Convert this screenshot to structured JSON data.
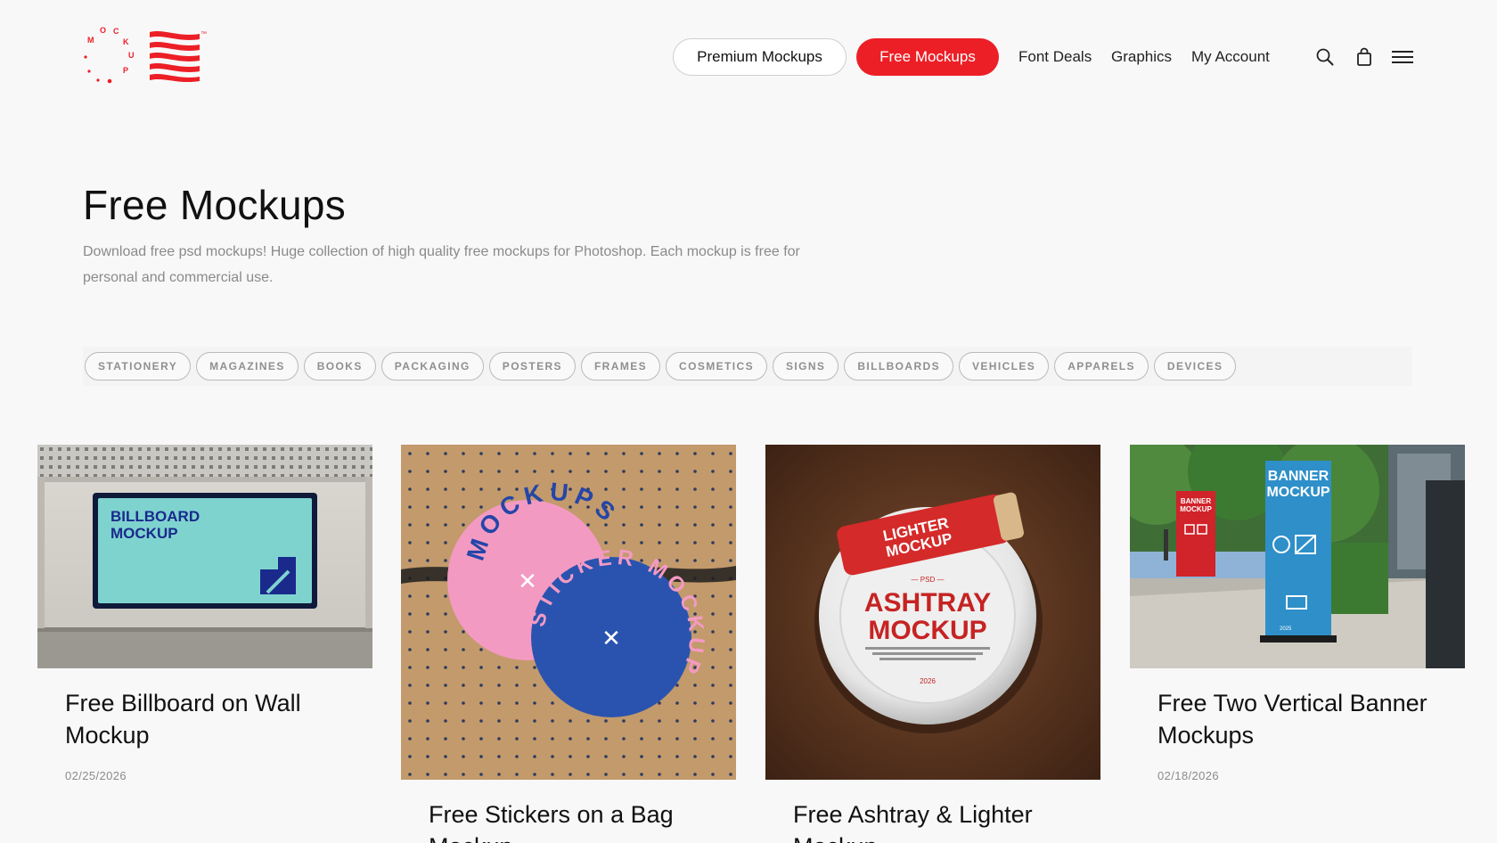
{
  "logo": {
    "ring_text": "MOCKUP",
    "ring_letters": [
      "M",
      "O",
      "C",
      "K",
      "U",
      "P"
    ],
    "tm": "™",
    "brand_color": "#ec1f26"
  },
  "nav": {
    "premium": "Premium Mockups",
    "free": "Free Mockups",
    "font_deals": "Font Deals",
    "graphics": "Graphics",
    "account": "My Account",
    "icons": [
      "search-icon",
      "shopping-bag-icon",
      "hamburger-menu-icon"
    ]
  },
  "hero": {
    "title": "Free Mockups",
    "description": "Download free psd mockups! Huge collection of high quality free mockups for Photoshop. Each mockup is free for personal and commercial use."
  },
  "categories": [
    "STATIONERY",
    "MAGAZINES",
    "BOOKS",
    "PACKAGING",
    "POSTERS",
    "FRAMES",
    "COSMETICS",
    "SIGNS",
    "BILLBOARDS",
    "VEHICLES",
    "APPARELS",
    "DEVICES"
  ],
  "cards": [
    {
      "title": "Free Billboard on Wall Mockup",
      "date": "02/25/2026",
      "image_text": [
        "BILLBOARD",
        "MOCKUP"
      ]
    },
    {
      "title": "Free Stickers on a Bag Mockup",
      "date": "",
      "image_text": [
        "MOCKUPS",
        "STICKER MOCKUP"
      ]
    },
    {
      "title": "Free Ashtray & Lighter Mockup",
      "date": "",
      "image_text": [
        "LIGHTER",
        "MOCKUP",
        "— PSD —",
        "ASHTRAY",
        "MOCKUP",
        "2026"
      ]
    },
    {
      "title": "Free Two Vertical Banner Mockups",
      "date": "02/18/2026",
      "image_text": [
        "BANNER",
        "MOCKUP",
        "2025"
      ]
    }
  ]
}
